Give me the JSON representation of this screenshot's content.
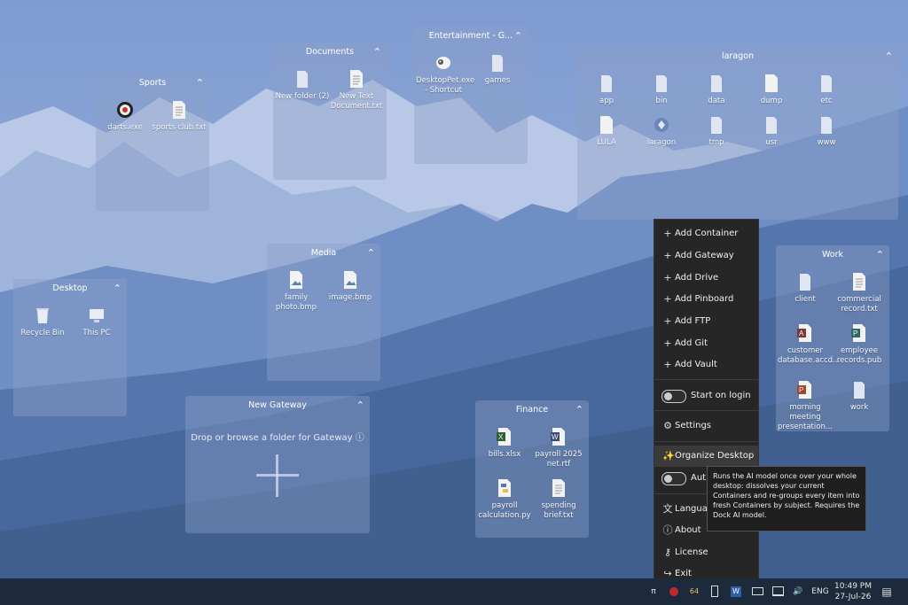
{
  "colors": {
    "accent": "#4a8ee0",
    "taskbar": "#1c2a3c",
    "menu_bg": "#262626"
  },
  "containers": {
    "sports": {
      "title": "Sports",
      "items": [
        {
          "label": "darts.exe",
          "icon": "dartboard-icon"
        },
        {
          "label": "sports club.txt",
          "icon": "text-file-icon"
        }
      ]
    },
    "documents": {
      "title": "Documents",
      "items": [
        {
          "label": "New folder (2)",
          "icon": "folder-icon"
        },
        {
          "label": "New Text Document.txt",
          "icon": "text-file-icon"
        }
      ]
    },
    "entertainment": {
      "title": "Entertainment - G...",
      "items": [
        {
          "label": "DesktopPet.exe - Shortcut",
          "icon": "sheep-icon"
        },
        {
          "label": "games",
          "icon": "folder-icon"
        }
      ]
    },
    "laragon": {
      "title": "laragon",
      "items": [
        {
          "label": "app",
          "icon": "folder-icon"
        },
        {
          "label": "bin",
          "icon": "folder-icon"
        },
        {
          "label": "data",
          "icon": "folder-icon"
        },
        {
          "label": "dump",
          "icon": "file-icon"
        },
        {
          "label": "etc",
          "icon": "folder-icon"
        },
        {
          "label": "LULA",
          "icon": "file-icon"
        },
        {
          "label": "laragon",
          "icon": "laragon-icon"
        },
        {
          "label": "tmp",
          "icon": "folder-icon"
        },
        {
          "label": "usr",
          "icon": "folder-icon"
        },
        {
          "label": "www",
          "icon": "folder-icon"
        }
      ]
    },
    "media": {
      "title": "Media",
      "items": [
        {
          "label": "family photo.bmp",
          "icon": "image-file-icon"
        },
        {
          "label": "image.bmp",
          "icon": "image-file-icon"
        }
      ]
    },
    "desktop": {
      "title": "Desktop",
      "items": [
        {
          "label": "Recycle Bin",
          "icon": "recycle-bin-icon"
        },
        {
          "label": "This PC",
          "icon": "computer-icon"
        }
      ]
    },
    "gateway": {
      "title": "New Gateway",
      "drop_text": "Drop or browse a folder for Gateway ⓘ"
    },
    "finance": {
      "title": "Finance",
      "items": [
        {
          "label": "bills.xlsx",
          "icon": "excel-icon"
        },
        {
          "label": "payroll 2025 net.rtf",
          "icon": "word-icon"
        },
        {
          "label": "payroll calculation.py",
          "icon": "python-icon"
        },
        {
          "label": "spending brief.txt",
          "icon": "text-file-icon"
        }
      ]
    },
    "work": {
      "title": "Work",
      "items": [
        {
          "label": "client",
          "icon": "folder-icon"
        },
        {
          "label": "commercial record.txt",
          "icon": "text-file-icon"
        },
        {
          "label": "customer database.accd...",
          "icon": "access-icon"
        },
        {
          "label": "employee records.pub",
          "icon": "publisher-icon"
        },
        {
          "label": "morning meeting presentation...",
          "icon": "powerpoint-icon"
        },
        {
          "label": "work",
          "icon": "folder-icon"
        }
      ]
    }
  },
  "menu": {
    "add_items": [
      {
        "label": "Add Container"
      },
      {
        "label": "Add Gateway"
      },
      {
        "label": "Add Drive"
      },
      {
        "label": "Add Pinboard"
      },
      {
        "label": "Add FTP"
      },
      {
        "label": "Add Git"
      },
      {
        "label": "Add Vault"
      }
    ],
    "start_on_login": "Start on login",
    "settings": "Settings",
    "organize": "Organize Desktop",
    "auto": "Aut",
    "language": "Langua",
    "about": "About",
    "license": "License",
    "exit": "Exit"
  },
  "tooltip": {
    "text": "Runs the AI model once over your whole desktop: dissolves your current Containers and re-groups every item into fresh Containers by subject. Requires the Dock AI model."
  },
  "taskbar": {
    "tray_up": "π",
    "badge": "64",
    "lang": "ENG",
    "time": "10:49 PM",
    "date": "27-Jul-26"
  }
}
